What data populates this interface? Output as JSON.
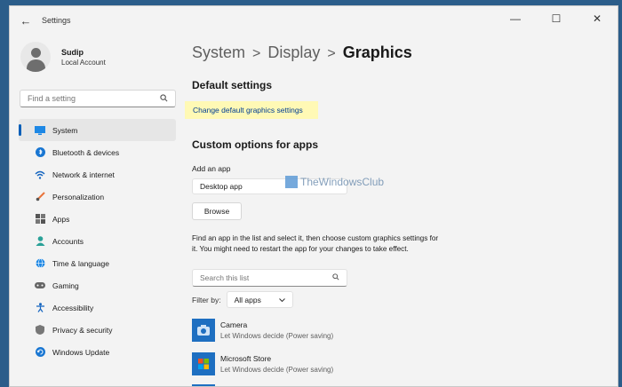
{
  "window": {
    "title": "Settings",
    "back_icon": "back-arrow-icon",
    "minimize": "—",
    "maximize": "☐",
    "close": "✕"
  },
  "profile": {
    "name": "Sudip",
    "account": "Local Account"
  },
  "search": {
    "placeholder": "Find a setting"
  },
  "nav": [
    {
      "label": "System",
      "icon": "monitor-icon",
      "active": true
    },
    {
      "label": "Bluetooth & devices",
      "icon": "bluetooth-icon"
    },
    {
      "label": "Network & internet",
      "icon": "wifi-icon"
    },
    {
      "label": "Personalization",
      "icon": "brush-icon"
    },
    {
      "label": "Apps",
      "icon": "apps-icon"
    },
    {
      "label": "Accounts",
      "icon": "person-icon"
    },
    {
      "label": "Time & language",
      "icon": "globe-icon"
    },
    {
      "label": "Gaming",
      "icon": "gamepad-icon"
    },
    {
      "label": "Accessibility",
      "icon": "accessibility-icon"
    },
    {
      "label": "Privacy & security",
      "icon": "shield-icon"
    },
    {
      "label": "Windows Update",
      "icon": "update-icon"
    }
  ],
  "breadcrumb": {
    "part1": "System",
    "part2": "Display",
    "current": "Graphics",
    "sep": ">"
  },
  "default_settings": {
    "title": "Default settings",
    "link": "Change default graphics settings"
  },
  "custom": {
    "title": "Custom options for apps",
    "add_label": "Add an app",
    "app_type": "Desktop app",
    "browse": "Browse",
    "description": "Find an app in the list and select it, then choose custom graphics settings for it. You might need to restart the app for your changes to take effect.",
    "list_search_placeholder": "Search this list",
    "filter_label": "Filter by:",
    "filter_value": "All apps"
  },
  "apps": [
    {
      "name": "Camera",
      "status": "Let Windows decide (Power saving)",
      "icon": "camera-icon"
    },
    {
      "name": "Microsoft Store",
      "status": "Let Windows decide (Power saving)",
      "icon": "store-icon"
    }
  ],
  "watermark": {
    "text": "TheWindowsClub"
  }
}
